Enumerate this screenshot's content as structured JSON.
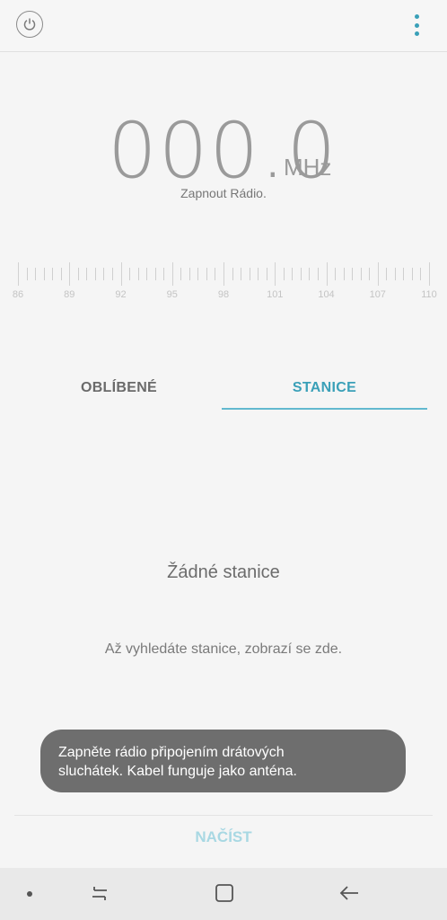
{
  "header": {
    "power_icon": "power-icon",
    "more_icon": "more-vertical-icon"
  },
  "tuner": {
    "frequency": "000.0",
    "unit": "MHz",
    "status": "Zapnout Rádio.",
    "scale_labels": [
      "86",
      "89",
      "92",
      "95",
      "98",
      "101",
      "104",
      "107",
      "110"
    ]
  },
  "tabs": {
    "favorites": "OBLÍBENÉ",
    "stations": "STANICE",
    "active": "stations"
  },
  "empty_state": {
    "title": "Žádné stanice",
    "message": "Až vyhledáte stanice, zobrazí se zde."
  },
  "toast": {
    "line1": "Zapněte rádio připojením drátových",
    "line2": "sluchátek. Kabel funguje jako anténa."
  },
  "footer": {
    "load_label": "NAČÍST"
  },
  "navbar": {
    "icons": [
      "nav-dot-icon",
      "recent-apps-icon",
      "home-icon",
      "back-icon"
    ]
  },
  "colors": {
    "accent": "#3aa0b8",
    "accent_disabled": "#a8d8e3",
    "toast_bg": "#6e6e6e"
  }
}
